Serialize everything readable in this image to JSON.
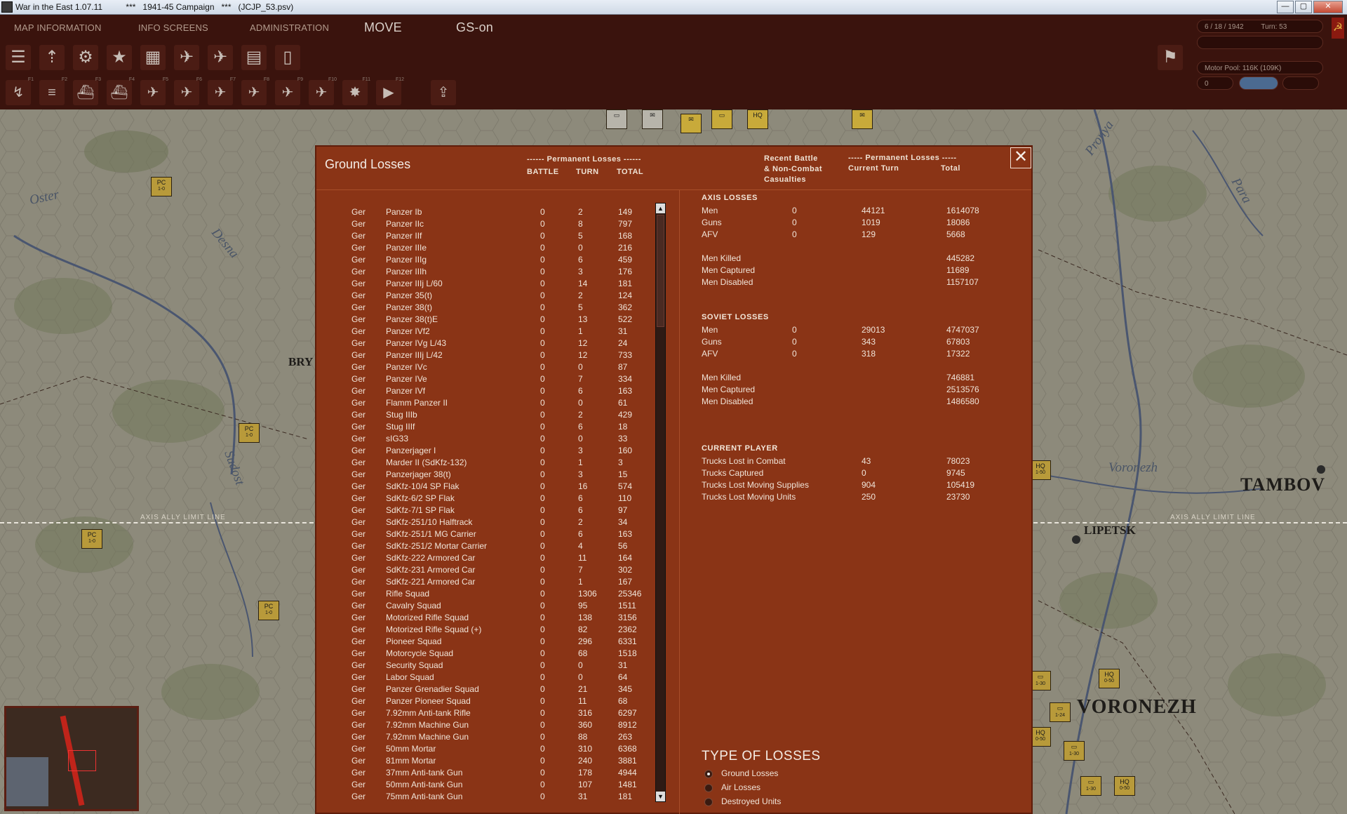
{
  "titlebar": {
    "title": "War in the East 1.07.11          ***   1941-45 Campaign   ***   (JCJP_53.psv)",
    "min": "—",
    "max": "▢",
    "close": "✕"
  },
  "menu": {
    "map_info": "MAP INFORMATION",
    "info_screens": "INFO SCREENS",
    "administration": "ADMINISTRATION",
    "move": "MOVE",
    "gs": "GS-on"
  },
  "status": {
    "date": "6 / 18 / 1942",
    "turn": "Turn: 53",
    "motor_pool": "Motor Pool: 116K (109K)",
    "counter": "0"
  },
  "map": {
    "labels": {
      "bry": "BRY",
      "tambov": "TAMBOV",
      "lipetsk": "LIPETSK",
      "voronezh": "VORONEZH"
    },
    "rivers": {
      "oster": "Oster",
      "desna": "Desna",
      "sudost": "Sudost",
      "pronya": "Pronya",
      "para": "Para",
      "voronezh": "Voronezh"
    },
    "limit_line": "AXIS ALLY LIMIT LINE"
  },
  "dialog": {
    "title": "Ground Losses",
    "close": "✕",
    "hdr_perm": "------ Permanent Losses ------",
    "col_battle": "BATTLE",
    "col_turn": "TURN",
    "col_total": "TOTAL",
    "hdr_recent": "Recent Battle\n& Non-Combat\nCasualties",
    "hdr_perm2": "----- Permanent Losses -----",
    "hdr_current": "Current Turn",
    "hdr_total": "Total",
    "scroll_up": "▲",
    "scroll_down": "▼",
    "rows": [
      {
        "n": "Ger",
        "u": "Panzer Ib",
        "b": "0",
        "t": "2",
        "tot": "149"
      },
      {
        "n": "Ger",
        "u": "Panzer IIc",
        "b": "0",
        "t": "8",
        "tot": "797"
      },
      {
        "n": "Ger",
        "u": "Panzer IIf",
        "b": "0",
        "t": "5",
        "tot": "168"
      },
      {
        "n": "Ger",
        "u": "Panzer IIIe",
        "b": "0",
        "t": "0",
        "tot": "216"
      },
      {
        "n": "Ger",
        "u": "Panzer IIIg",
        "b": "0",
        "t": "6",
        "tot": "459"
      },
      {
        "n": "Ger",
        "u": "Panzer IIIh",
        "b": "0",
        "t": "3",
        "tot": "176"
      },
      {
        "n": "Ger",
        "u": "Panzer IIIj L/60",
        "b": "0",
        "t": "14",
        "tot": "181"
      },
      {
        "n": "Ger",
        "u": "Panzer 35(t)",
        "b": "0",
        "t": "2",
        "tot": "124"
      },
      {
        "n": "Ger",
        "u": "Panzer 38(t)",
        "b": "0",
        "t": "5",
        "tot": "362"
      },
      {
        "n": "Ger",
        "u": "Panzer 38(t)E",
        "b": "0",
        "t": "13",
        "tot": "522"
      },
      {
        "n": "Ger",
        "u": "Panzer IVf2",
        "b": "0",
        "t": "1",
        "tot": "31"
      },
      {
        "n": "Ger",
        "u": "Panzer IVg L/43",
        "b": "0",
        "t": "12",
        "tot": "24"
      },
      {
        "n": "Ger",
        "u": "Panzer IIIj L/42",
        "b": "0",
        "t": "12",
        "tot": "733"
      },
      {
        "n": "Ger",
        "u": "Panzer IVc",
        "b": "0",
        "t": "0",
        "tot": "87"
      },
      {
        "n": "Ger",
        "u": "Panzer IVe",
        "b": "0",
        "t": "7",
        "tot": "334"
      },
      {
        "n": "Ger",
        "u": "Panzer IVf",
        "b": "0",
        "t": "6",
        "tot": "163"
      },
      {
        "n": "Ger",
        "u": "Flamm Panzer II",
        "b": "0",
        "t": "0",
        "tot": "61"
      },
      {
        "n": "Ger",
        "u": "Stug IIIb",
        "b": "0",
        "t": "2",
        "tot": "429"
      },
      {
        "n": "Ger",
        "u": "Stug IIIf",
        "b": "0",
        "t": "6",
        "tot": "18"
      },
      {
        "n": "Ger",
        "u": "sIG33",
        "b": "0",
        "t": "0",
        "tot": "33"
      },
      {
        "n": "Ger",
        "u": "Panzerjager I",
        "b": "0",
        "t": "3",
        "tot": "160"
      },
      {
        "n": "Ger",
        "u": "Marder II (SdKfz-132)",
        "b": "0",
        "t": "1",
        "tot": "3"
      },
      {
        "n": "Ger",
        "u": "Panzerjager 38(t)",
        "b": "0",
        "t": "3",
        "tot": "15"
      },
      {
        "n": "Ger",
        "u": "SdKfz-10/4 SP Flak",
        "b": "0",
        "t": "16",
        "tot": "574"
      },
      {
        "n": "Ger",
        "u": "SdKfz-6/2 SP Flak",
        "b": "0",
        "t": "6",
        "tot": "110"
      },
      {
        "n": "Ger",
        "u": "SdKfz-7/1 SP Flak",
        "b": "0",
        "t": "6",
        "tot": "97"
      },
      {
        "n": "Ger",
        "u": "SdKfz-251/10 Halftrack",
        "b": "0",
        "t": "2",
        "tot": "34"
      },
      {
        "n": "Ger",
        "u": "SdKfz-251/1 MG Carrier",
        "b": "0",
        "t": "6",
        "tot": "163"
      },
      {
        "n": "Ger",
        "u": "SdKfz-251/2 Mortar Carrier",
        "b": "0",
        "t": "4",
        "tot": "56"
      },
      {
        "n": "Ger",
        "u": "SdKfz-222 Armored Car",
        "b": "0",
        "t": "11",
        "tot": "164"
      },
      {
        "n": "Ger",
        "u": "SdKfz-231 Armored Car",
        "b": "0",
        "t": "7",
        "tot": "302"
      },
      {
        "n": "Ger",
        "u": "SdKfz-221 Armored Car",
        "b": "0",
        "t": "1",
        "tot": "167"
      },
      {
        "n": "Ger",
        "u": "Rifle Squad",
        "b": "0",
        "t": "1306",
        "tot": "25346"
      },
      {
        "n": "Ger",
        "u": "Cavalry Squad",
        "b": "0",
        "t": "95",
        "tot": "1511"
      },
      {
        "n": "Ger",
        "u": "Motorized Rifle Squad",
        "b": "0",
        "t": "138",
        "tot": "3156"
      },
      {
        "n": "Ger",
        "u": "Motorized Rifle Squad (+)",
        "b": "0",
        "t": "82",
        "tot": "2362"
      },
      {
        "n": "Ger",
        "u": "Pioneer Squad",
        "b": "0",
        "t": "296",
        "tot": "6331"
      },
      {
        "n": "Ger",
        "u": "Motorcycle Squad",
        "b": "0",
        "t": "68",
        "tot": "1518"
      },
      {
        "n": "Ger",
        "u": "Security Squad",
        "b": "0",
        "t": "0",
        "tot": "31"
      },
      {
        "n": "Ger",
        "u": "Labor Squad",
        "b": "0",
        "t": "0",
        "tot": "64"
      },
      {
        "n": "Ger",
        "u": "Panzer Grenadier Squad",
        "b": "0",
        "t": "21",
        "tot": "345"
      },
      {
        "n": "Ger",
        "u": "Panzer Pioneer Squad",
        "b": "0",
        "t": "11",
        "tot": "68"
      },
      {
        "n": "Ger",
        "u": "7.92mm Anti-tank Rifle",
        "b": "0",
        "t": "316",
        "tot": "6297"
      },
      {
        "n": "Ger",
        "u": "7.92mm Machine Gun",
        "b": "0",
        "t": "360",
        "tot": "8912"
      },
      {
        "n": "Ger",
        "u": "7.92mm Machine Gun",
        "b": "0",
        "t": "88",
        "tot": "263"
      },
      {
        "n": "Ger",
        "u": "50mm Mortar",
        "b": "0",
        "t": "310",
        "tot": "6368"
      },
      {
        "n": "Ger",
        "u": "81mm Mortar",
        "b": "0",
        "t": "240",
        "tot": "3881"
      },
      {
        "n": "Ger",
        "u": "37mm Anti-tank Gun",
        "b": "0",
        "t": "178",
        "tot": "4944"
      },
      {
        "n": "Ger",
        "u": "50mm Anti-tank Gun",
        "b": "0",
        "t": "107",
        "tot": "1481"
      },
      {
        "n": "Ger",
        "u": "75mm Anti-tank Gun",
        "b": "0",
        "t": "31",
        "tot": "181"
      }
    ],
    "axis": {
      "title": "AXIS LOSSES",
      "rows": [
        {
          "l": "Men",
          "r": "0",
          "c": "44121",
          "t": "1614078"
        },
        {
          "l": "Guns",
          "r": "0",
          "c": "1019",
          "t": "18086"
        },
        {
          "l": "AFV",
          "r": "0",
          "c": "129",
          "t": "5668"
        },
        {
          "l": "Men Killed",
          "r": "",
          "c": "",
          "t": "445282"
        },
        {
          "l": "Men Captured",
          "r": "",
          "c": "",
          "t": "11689"
        },
        {
          "l": "Men Disabled",
          "r": "",
          "c": "",
          "t": "1157107"
        }
      ]
    },
    "soviet": {
      "title": "SOVIET LOSSES",
      "rows": [
        {
          "l": "Men",
          "r": "0",
          "c": "29013",
          "t": "4747037"
        },
        {
          "l": "Guns",
          "r": "0",
          "c": "343",
          "t": "67803"
        },
        {
          "l": "AFV",
          "r": "0",
          "c": "318",
          "t": "17322"
        },
        {
          "l": "Men Killed",
          "r": "",
          "c": "",
          "t": "746881"
        },
        {
          "l": "Men Captured",
          "r": "",
          "c": "",
          "t": "2513576"
        },
        {
          "l": "Men Disabled",
          "r": "",
          "c": "",
          "t": "1486580"
        }
      ]
    },
    "player": {
      "title": "CURRENT PLAYER",
      "rows": [
        {
          "l": "Trucks Lost in Combat",
          "c": "43",
          "t": "78023"
        },
        {
          "l": "Trucks Captured",
          "c": "0",
          "t": "9745"
        },
        {
          "l": "Trucks Lost Moving Supplies",
          "c": "904",
          "t": "105419"
        },
        {
          "l": "Trucks Lost Moving Units",
          "c": "250",
          "t": "23730"
        }
      ]
    },
    "type_title": "TYPE OF LOSSES",
    "types": [
      {
        "label": "Ground Losses",
        "selected": true
      },
      {
        "label": "Air Losses",
        "selected": false
      },
      {
        "label": "Destroyed Units",
        "selected": false
      }
    ]
  }
}
